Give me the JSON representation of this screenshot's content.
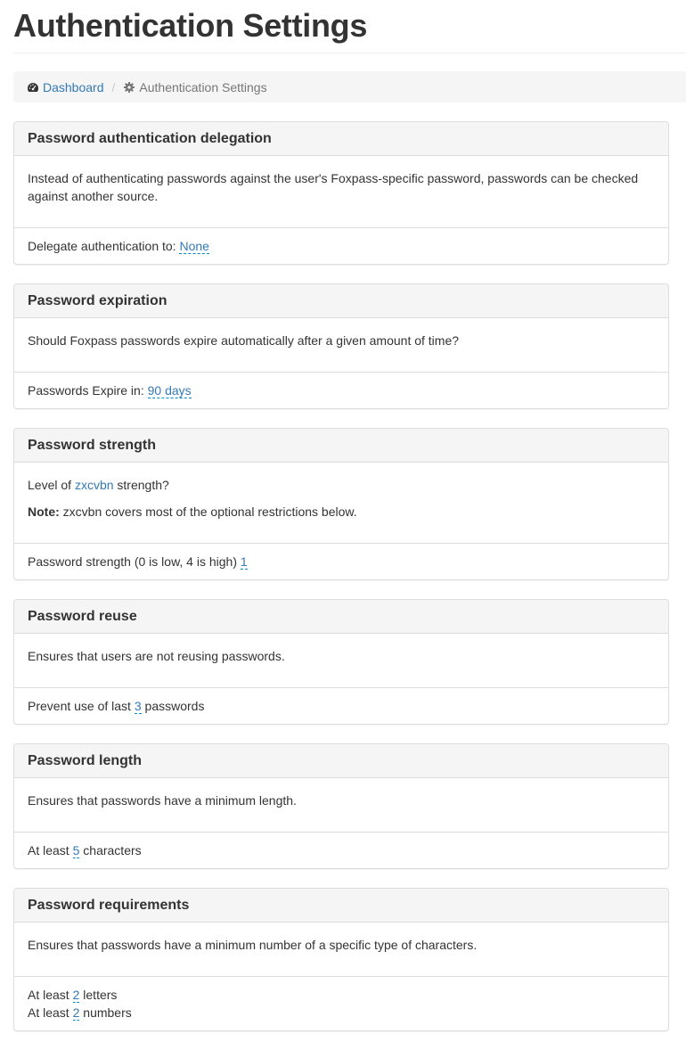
{
  "page": {
    "title": "Authentication Settings"
  },
  "breadcrumb": {
    "items": [
      {
        "label": "Dashboard",
        "icon": "dashboard-icon"
      },
      {
        "label": "Authentication Settings",
        "icon": "gear-icon"
      }
    ],
    "separator": "/"
  },
  "panels": {
    "delegation": {
      "title": "Password authentication delegation",
      "description": "Instead of authenticating passwords against the user's Foxpass-specific password, passwords can be checked against another source.",
      "footer_label": "Delegate authentication to: ",
      "value": "None"
    },
    "expiration": {
      "title": "Password expiration",
      "description": "Should Foxpass passwords expire automatically after a given amount of time?",
      "footer_label": "Passwords Expire in: ",
      "value": "90 days"
    },
    "strength": {
      "title": "Password strength",
      "description_prefix": "Level of ",
      "description_link": "zxcvbn",
      "description_suffix": " strength?",
      "note_label": "Note:",
      "note_text": " zxcvbn covers most of the optional restrictions below.",
      "footer_label": "Password strength (0 is low, 4 is high) ",
      "value": "1"
    },
    "reuse": {
      "title": "Password reuse",
      "description": "Ensures that users are not reusing passwords.",
      "footer_prefix": "Prevent use of last ",
      "value": "3",
      "footer_suffix": " passwords"
    },
    "length": {
      "title": "Password length",
      "description": "Ensures that passwords have a minimum length.",
      "footer_prefix": "At least ",
      "value": "5",
      "footer_suffix": " characters"
    },
    "requirements": {
      "title": "Password requirements",
      "description": "Ensures that passwords have a minimum number of a specific type of characters.",
      "rows": [
        {
          "prefix": "At least ",
          "value": "2",
          "suffix": " letters"
        },
        {
          "prefix": "At least ",
          "value": "2",
          "suffix": " numbers"
        }
      ]
    }
  }
}
